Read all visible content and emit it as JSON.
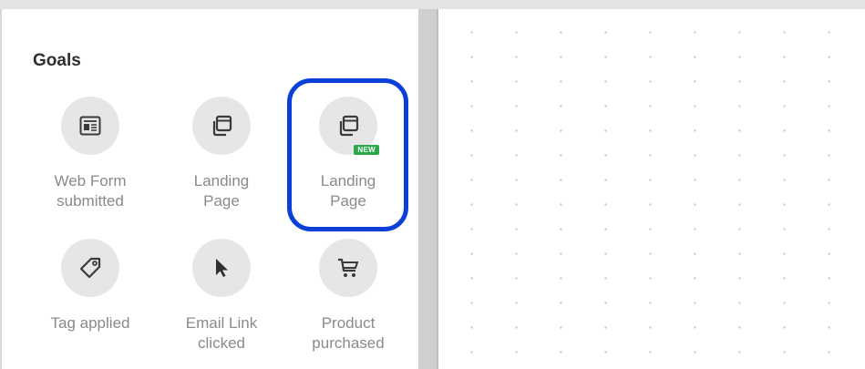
{
  "panel": {
    "title": "Goals",
    "items": [
      {
        "icon": "web-form-icon",
        "label_line1": "Web Form",
        "label_line2": "submitted"
      },
      {
        "icon": "landing-page-icon",
        "label_line1": "Landing",
        "label_line2": "Page"
      },
      {
        "icon": "landing-page-icon",
        "label_line1": "Landing",
        "label_line2": "Page",
        "badge": "NEW"
      },
      {
        "icon": "tag-icon",
        "label_line1": "Tag applied",
        "label_line2": ""
      },
      {
        "icon": "cursor-icon",
        "label_line1": "Email Link",
        "label_line2": "clicked"
      },
      {
        "icon": "cart-icon",
        "label_line1": "Product",
        "label_line2": "purchased"
      }
    ]
  },
  "colors": {
    "highlight": "#0a3fd8",
    "badge": "#2aa84a",
    "icon_bg": "#e6e6e6",
    "label": "#8a8a8a"
  }
}
